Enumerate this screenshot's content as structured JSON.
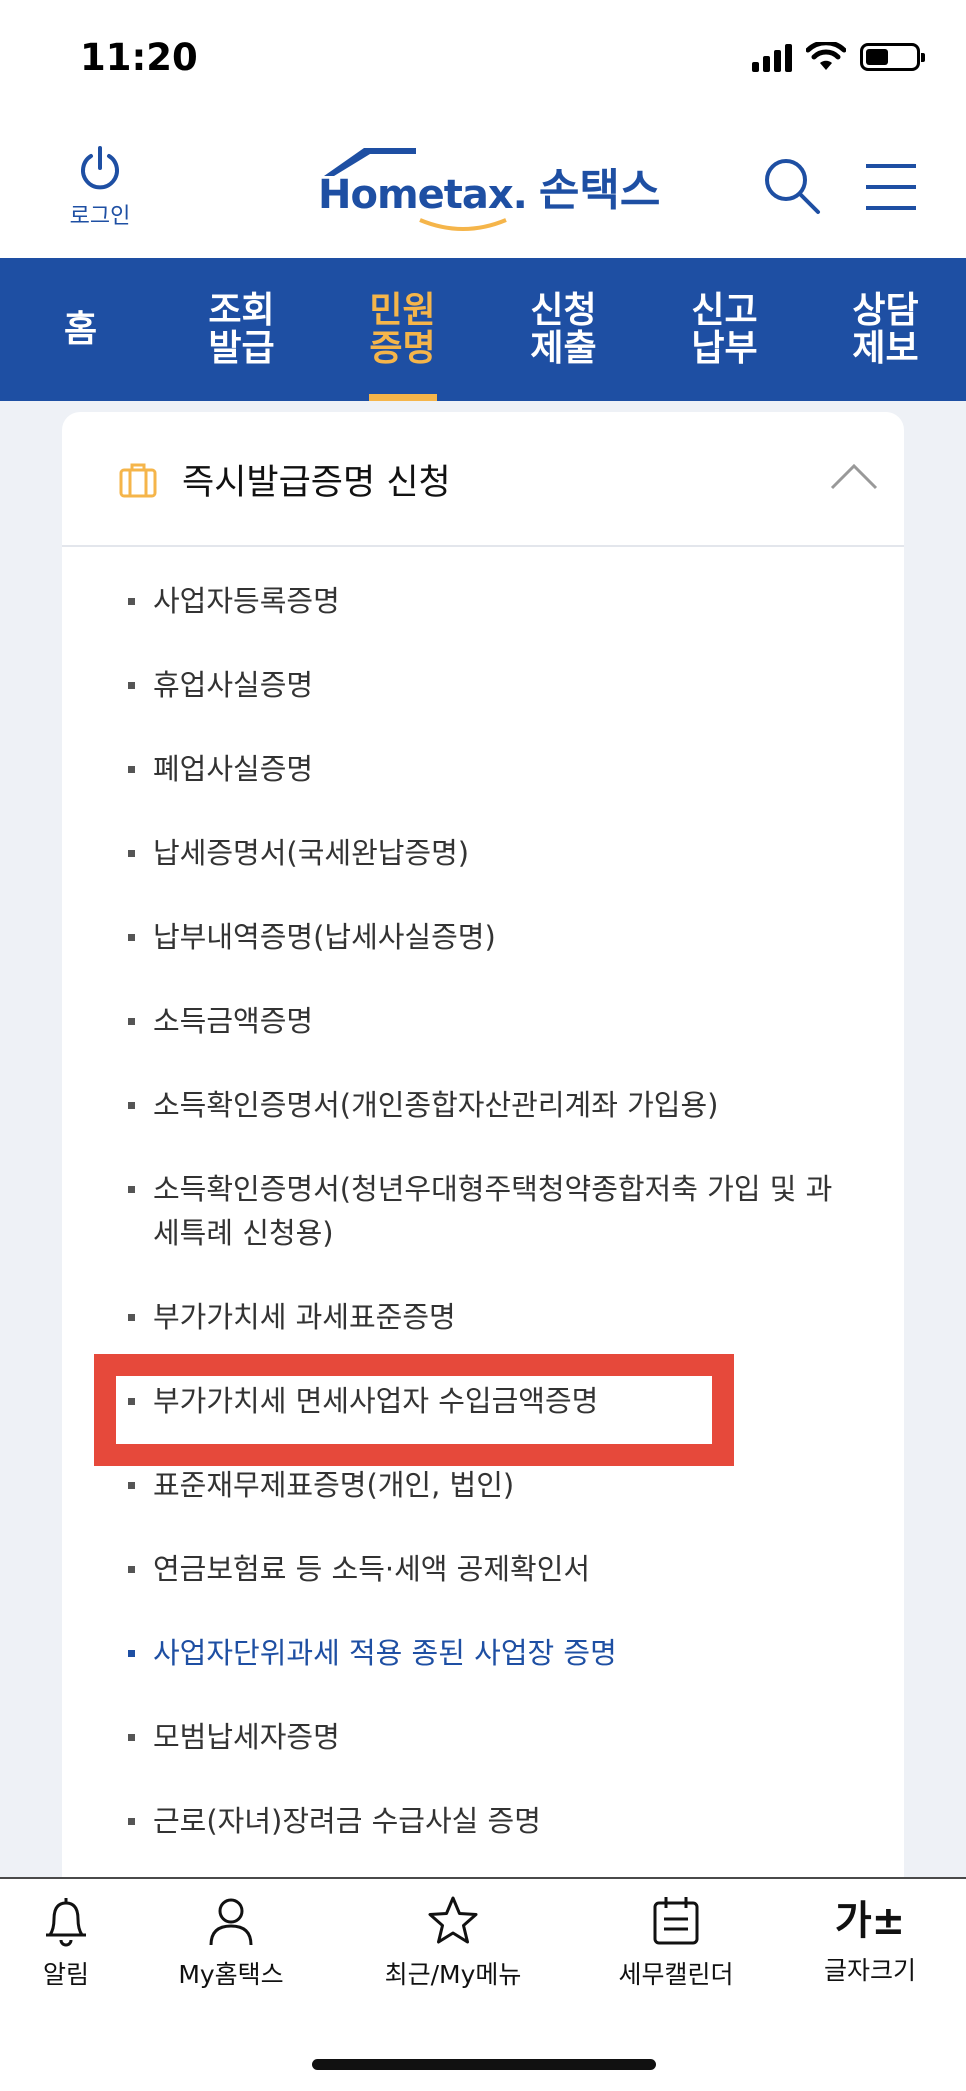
{
  "status": {
    "time": "11:20"
  },
  "header": {
    "login_label": "로그인",
    "logo_en": "Hometax.",
    "logo_ko": "손택스"
  },
  "nav": [
    {
      "label": "홈",
      "active": false
    },
    {
      "label": "조회\n발급",
      "active": false
    },
    {
      "label": "민원\n증명",
      "active": true
    },
    {
      "label": "신청\n제출",
      "active": false
    },
    {
      "label": "신고\n납부",
      "active": false
    },
    {
      "label": "상담\n제보",
      "active": false
    }
  ],
  "section": {
    "title": "즉시발급증명 신청",
    "items": [
      "사업자등록증명",
      "휴업사실증명",
      "폐업사실증명",
      "납세증명서(국세완납증명)",
      "납부내역증명(납세사실증명)",
      "소득금액증명",
      "소득확인증명서(개인종합자산관리계좌 가입용)",
      "소득확인증명서(청년우대형주택청약종합저축 가입 및 과세특례 신청용)",
      "부가가치세 과세표준증명",
      "부가가치세 면세사업자 수입금액증명",
      "표준재무제표증명(개인, 법인)",
      "연금보험료 등 소득·세액 공제확인서",
      "사업자단위과세 적용 종된 사업장 증명",
      "모범납세자증명",
      "근로(자녀)장려금 수급사실 증명"
    ]
  },
  "bottom_tabs": [
    {
      "label": "알림",
      "icon": "bell-icon"
    },
    {
      "label": "My홈택스",
      "icon": "person-icon"
    },
    {
      "label": "최근/My메뉴",
      "icon": "star-icon"
    },
    {
      "label": "세무캘린더",
      "icon": "calendar-icon"
    },
    {
      "label": "글자크기",
      "icon": "font-size-icon",
      "glyph": "가±"
    }
  ],
  "colors": {
    "brand": "#1e4fa3",
    "active_nav": "#f5b54a",
    "highlight": "#e6493b"
  }
}
